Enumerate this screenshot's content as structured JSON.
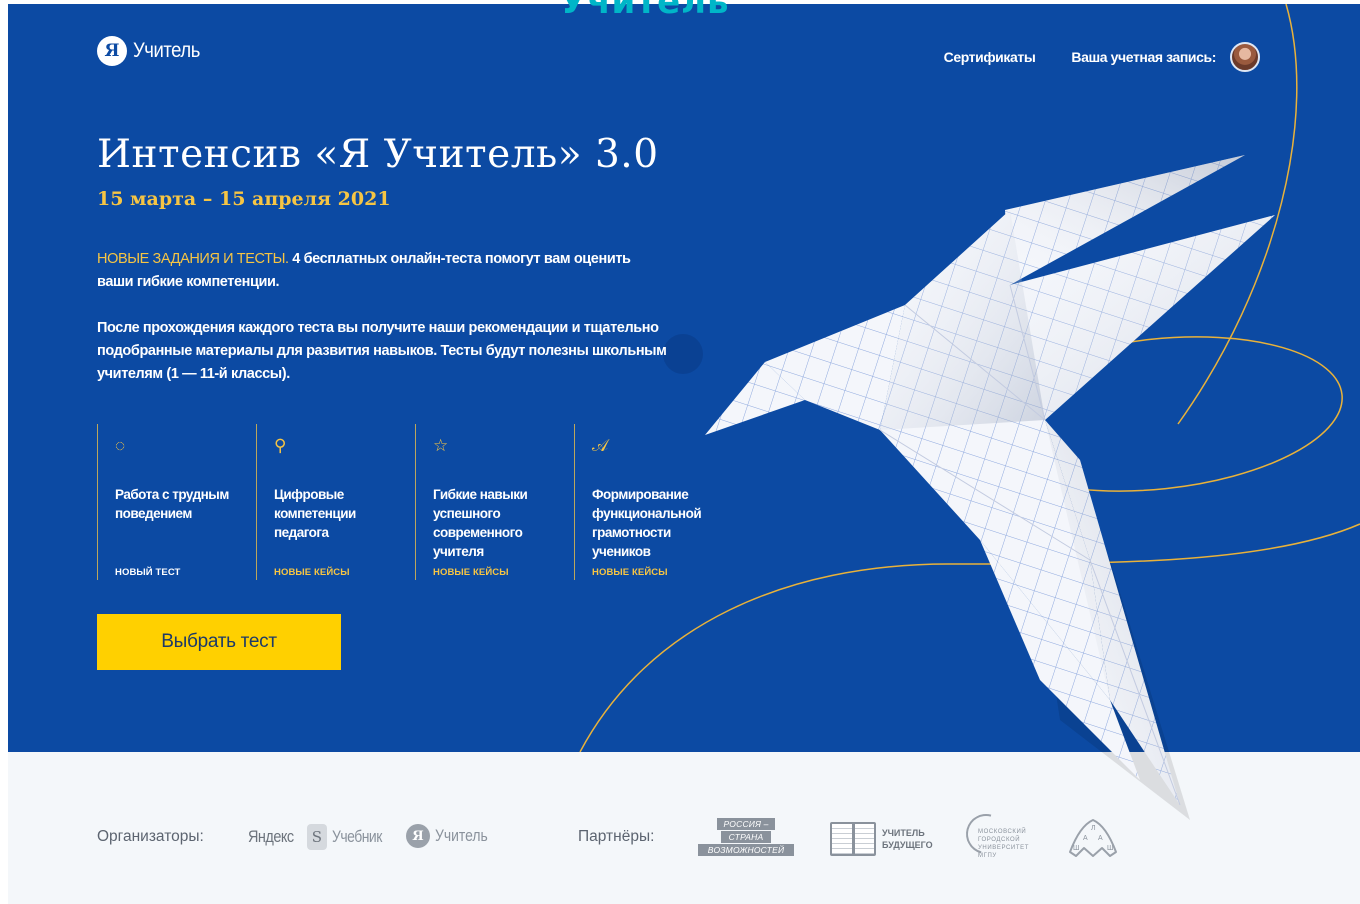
{
  "top_cut_text": "Учитель",
  "header": {
    "brand_mark": "Я",
    "brand_name": "Учитель",
    "nav_certificates": "Сертификаты",
    "nav_account": "Ваша учетная запись:"
  },
  "hero": {
    "title": "Интенсив «Я Учитель» 3.0",
    "dates": "15 марта – 15 апреля 2021",
    "intro_highlight": "НОВЫЕ ЗАДАНИЯ И ТЕСТЫ.",
    "intro_text": " 4 бесплатных онлайн-теста помогут вам оценить ваши гибкие компетенции.",
    "description": "После прохождения каждого теста вы получите наши рекомендации и тщательно подобранные материалы для развития навыков. Тесты будут полезны школьным учителям (1 — 11-й классы).",
    "cta_label": "Выбрать тест"
  },
  "features": [
    {
      "icon": "speech-bubble-icon",
      "glyph": "◌",
      "title": "Работа с трудным поведением",
      "tag": "НОВЫЙ ТЕСТ"
    },
    {
      "icon": "rocket-icon",
      "glyph": "⚲",
      "title": "Цифровые компетенции педагога",
      "tag": "НОВЫЕ КЕЙСЫ"
    },
    {
      "icon": "star-icon",
      "glyph": "☆",
      "title": "Гибкие навыки успешного современного учителя",
      "tag": "НОВЫЕ КЕЙСЫ"
    },
    {
      "icon": "letter-a-icon",
      "glyph": "𝒜",
      "title": "Формирование функциональной грамотности учеников",
      "tag": "НОВЫЕ КЕЙСЫ"
    }
  ],
  "footer": {
    "organizers_label": "Организаторы:",
    "partners_label": "Партнёры:",
    "org_yandex_textbook": {
      "yandex": "Яндекс",
      "s": "S",
      "textbook": "Учебник"
    },
    "org_ya_teacher": {
      "mark": "Я",
      "name": "Учитель"
    },
    "partner_russia": [
      "РОССИЯ –",
      "СТРАНА",
      "ВОЗМОЖНОСТЕЙ"
    ],
    "partner_teacher_future": "УЧИТЕЛЬ БУДУЩЕГО",
    "partner_mgpu": "МОСКОВСКИЙ ГОРОДСКОЙ УНИВЕРСИТЕТ МГПУ",
    "partner_shaa": [
      "Л",
      "А",
      "А",
      "Ш",
      "Ш"
    ]
  },
  "colors": {
    "hero_bg": "#0c4aa3",
    "accent_yellow": "#f6c544",
    "cta_yellow": "#ffd000",
    "footer_bg": "#f4f7fa"
  }
}
